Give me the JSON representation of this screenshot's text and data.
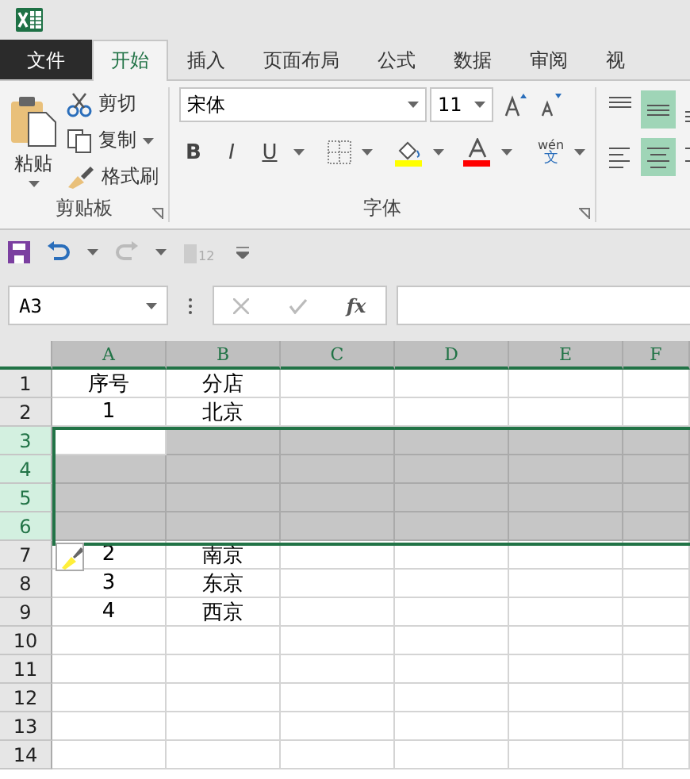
{
  "tabs": [
    {
      "label": "文件",
      "kind": "file",
      "selected": false
    },
    {
      "label": "开始",
      "kind": "tab",
      "selected": true
    },
    {
      "label": "插入",
      "kind": "tab",
      "selected": false
    },
    {
      "label": "页面布局",
      "kind": "tab",
      "selected": false
    },
    {
      "label": "公式",
      "kind": "tab",
      "selected": false
    },
    {
      "label": "数据",
      "kind": "tab",
      "selected": false
    },
    {
      "label": "审阅",
      "kind": "tab",
      "selected": false
    },
    {
      "label": "视",
      "kind": "tab",
      "selected": false
    }
  ],
  "clipboard": {
    "label": "剪贴板",
    "paste": "粘贴",
    "cut": "剪切",
    "copy": "复制",
    "format_painter": "格式刷"
  },
  "font": {
    "label": "字体",
    "bold": "B",
    "italic": "I",
    "underline": "U",
    "font_name": "宋体",
    "font_size": "11",
    "phonetic_top": "wén",
    "phonetic_bottom": "文"
  },
  "alignment": [
    {
      "kind": "top",
      "selected": false
    },
    {
      "kind": "middle",
      "selected": true
    },
    {
      "kind": "bottom",
      "selected": false
    },
    {
      "kind": "left",
      "selected": false
    },
    {
      "kind": "center",
      "selected": true
    },
    {
      "kind": "right",
      "selected": false
    }
  ],
  "quick_access": {
    "touch_label": "12"
  },
  "name_box": "A3",
  "formula_bar": {
    "function_label": "fx"
  },
  "sheet": {
    "columns": [
      "A",
      "B",
      "C",
      "D",
      "E",
      "F"
    ],
    "rows": [
      {
        "header": "1",
        "selected": false,
        "cells": [
          "序号",
          "分店"
        ]
      },
      {
        "header": "2",
        "selected": false,
        "cells": [
          "1",
          "北京"
        ]
      },
      {
        "header": "3",
        "selected": true
      },
      {
        "header": "4",
        "selected": true
      },
      {
        "header": "5",
        "selected": true
      },
      {
        "header": "6",
        "selected": true
      },
      {
        "header": "7",
        "selected": false,
        "cells": [
          "2",
          "南京"
        ]
      },
      {
        "header": "8",
        "selected": false,
        "cells": [
          "3",
          "东京"
        ]
      },
      {
        "header": "9",
        "selected": false,
        "cells": [
          "4",
          "西京"
        ]
      },
      {
        "header": "10",
        "selected": false
      },
      {
        "header": "11",
        "selected": false
      },
      {
        "header": "12",
        "selected": false
      },
      {
        "header": "13",
        "selected": false
      },
      {
        "header": "14",
        "selected": false
      }
    ]
  }
}
